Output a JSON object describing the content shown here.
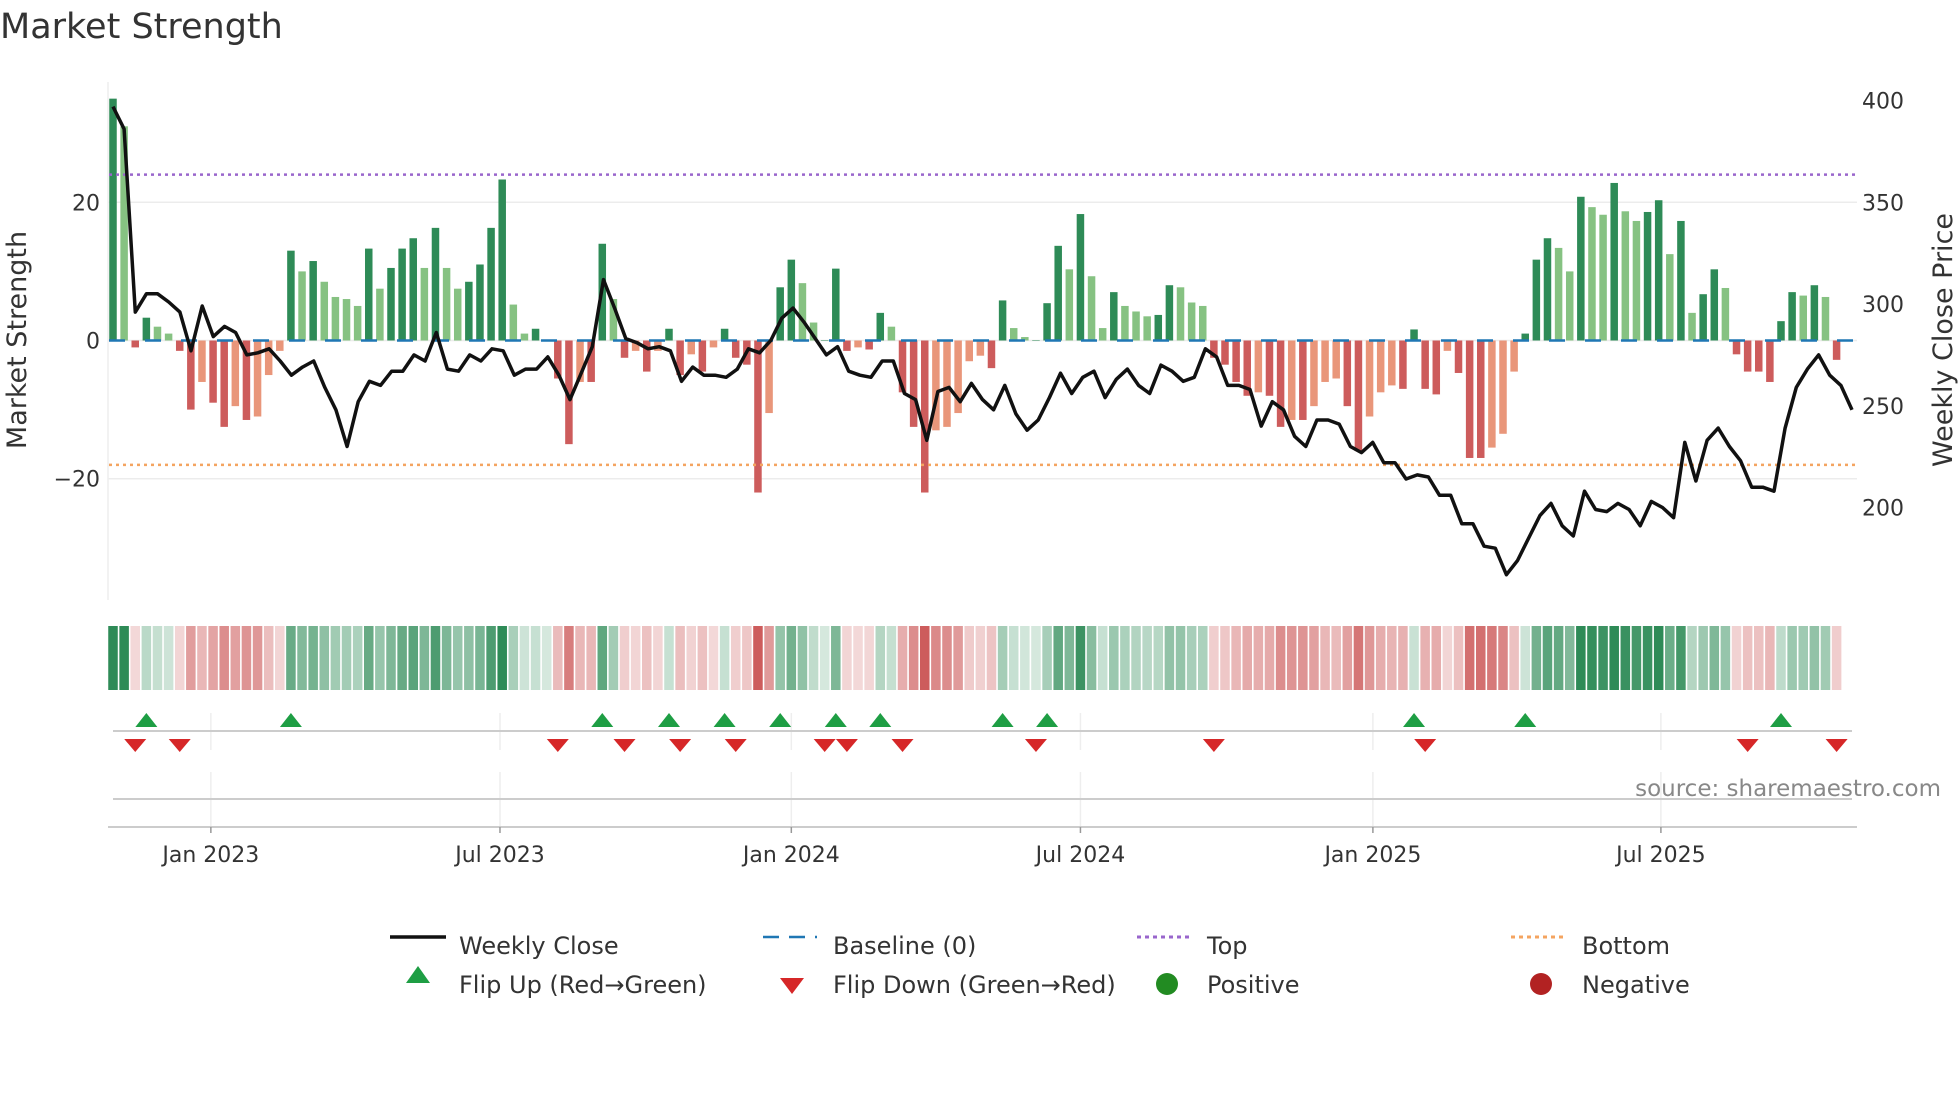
{
  "chart_data": {
    "type": "bar",
    "title": "Market Strength",
    "ylabel": "Market Strength",
    "y2label": "Weekly Close Price",
    "ylim": [
      -38,
      36
    ],
    "y2lim": [
      160,
      405
    ],
    "yticks": [
      {
        "v": 20,
        "label": "20"
      },
      {
        "v": 0,
        "label": "0"
      },
      {
        "v": -20,
        "label": "−20"
      }
    ],
    "y2ticks": [
      {
        "v": 400,
        "label": "400"
      },
      {
        "v": 350,
        "label": "350"
      },
      {
        "v": 300,
        "label": "300"
      },
      {
        "v": 250,
        "label": "250"
      },
      {
        "v": 200,
        "label": "200"
      }
    ],
    "xticks": [
      {
        "week": 8.8,
        "label": "Jan 2023"
      },
      {
        "week": 34.8,
        "label": "Jul 2023"
      },
      {
        "week": 61,
        "label": "Jan 2024"
      },
      {
        "week": 87,
        "label": "Jul 2024"
      },
      {
        "week": 113.3,
        "label": "Jan 2025"
      },
      {
        "week": 139.2,
        "label": "Jul 2025"
      }
    ],
    "frequency": "weekly",
    "top_level": 24,
    "bottom_level": -18,
    "strength": [
      35,
      31,
      -1,
      3.3,
      2,
      1,
      -1.5,
      -10,
      -6,
      -9,
      -12.5,
      -9.5,
      -11.5,
      -11,
      -5,
      -1.5,
      13,
      10,
      11.5,
      8.5,
      6.3,
      6,
      5,
      13.3,
      7.5,
      10.5,
      13.3,
      14.8,
      10.5,
      16.3,
      10.5,
      7.5,
      8.5,
      11,
      16.3,
      23.3,
      5.2,
      1,
      1.7,
      0,
      -5.5,
      -15,
      -6,
      -6,
      14,
      6,
      -2.5,
      -1.5,
      -4.5,
      -1.5,
      1.7,
      -5,
      -2,
      -4.5,
      -1,
      1.7,
      -2.5,
      -3.5,
      -22,
      -10.5,
      7.7,
      11.7,
      8.3,
      2.6,
      0,
      10.4,
      -1.5,
      -1,
      -1.3,
      4,
      2,
      -7.5,
      -12.5,
      -22,
      -13,
      -12.5,
      -10.5,
      -3,
      -2.2,
      -4,
      5.8,
      1.8,
      0.5,
      0,
      5.4,
      13.7,
      10.3,
      18.3,
      9.3,
      1.8,
      7,
      5,
      4.2,
      3.5,
      3.7,
      8,
      7.7,
      5.5,
      5,
      -2.5,
      -3.5,
      -6,
      -8,
      -7.5,
      -8,
      -12.5,
      -11.5,
      -11.5,
      -9.5,
      -6,
      -5.5,
      -9.5,
      -16,
      -11,
      -7.5,
      -6.5,
      -7,
      1.6,
      -7,
      -7.8,
      -1.5,
      -4.7,
      -17,
      -17,
      -15.5,
      -13.5,
      -4.5,
      1,
      11.7,
      14.8,
      13.4,
      10,
      20.8,
      19.3,
      18.2,
      22.8,
      18.7,
      17.3,
      18.6,
      20.3,
      12.5,
      17.3,
      4,
      6.7,
      10.3,
      7.6,
      -2,
      -4.5,
      -4.5,
      -6,
      2.8,
      7,
      6.5,
      8,
      6.3,
      -2.8
    ],
    "weekly_close": [
      397,
      386,
      296,
      305,
      305,
      301,
      296,
      277,
      299,
      284,
      289,
      286,
      275,
      276,
      278,
      272,
      265,
      269,
      272,
      259,
      248,
      230,
      252,
      262,
      260,
      267,
      267,
      275,
      272,
      286,
      268,
      267,
      275,
      272,
      278,
      277,
      265,
      268,
      268,
      274,
      265,
      253,
      266,
      279,
      312,
      298,
      283,
      281,
      278,
      279,
      277,
      262,
      269,
      265,
      265,
      264,
      268,
      278,
      276,
      282,
      293,
      298,
      291,
      283,
      275,
      279,
      267,
      265,
      264,
      272,
      272,
      256,
      253,
      233,
      257,
      259,
      252,
      261,
      253,
      248,
      260,
      246,
      238,
      243,
      254,
      266,
      256,
      264,
      267,
      254,
      263,
      268,
      260,
      256,
      270,
      267,
      262,
      264,
      278,
      274,
      260,
      260,
      258,
      240,
      252,
      248,
      235,
      230,
      243,
      243,
      241,
      230,
      227,
      232,
      222,
      222,
      214,
      216,
      215,
      206,
      206,
      192,
      192,
      181,
      180,
      167,
      174,
      185,
      196,
      202,
      191,
      186,
      208,
      199,
      198,
      202,
      199,
      191,
      203,
      200,
      195,
      232,
      213,
      233,
      239,
      230,
      223,
      210,
      210,
      208,
      239,
      259,
      268,
      275,
      265,
      260,
      248
    ],
    "flip_up_weeks": [
      3,
      16,
      44,
      50,
      55,
      60,
      65,
      69,
      80,
      84,
      117,
      127,
      150
    ],
    "flip_down_weeks": [
      2,
      6,
      40,
      46,
      51,
      56,
      64,
      66,
      71,
      83,
      99,
      118,
      147,
      155
    ],
    "legend": {
      "weekly_close": "Weekly Close",
      "baseline": "Baseline (0)",
      "top": "Top",
      "bottom": "Bottom",
      "flip_up": "Flip Up (Red→Green)",
      "flip_down": "Flip Down (Green→Red)",
      "positive": "Positive",
      "negative": "Negative"
    },
    "legend_placement": "bottom",
    "source": "source: sharemaestro.com",
    "colors": {
      "pos_strong": "#2e8b57",
      "pos_weak": "#86c282",
      "neg_strong": "#cd5c5c",
      "neg_weak": "#e9967a",
      "price": "#111111",
      "baseline": "#1f77b4",
      "top": "#9966cc",
      "bottom": "#f4a460",
      "flip_up": "#1e9e44",
      "flip_down": "#d62728",
      "positive": "#228b22",
      "negative": "#b22222"
    }
  }
}
